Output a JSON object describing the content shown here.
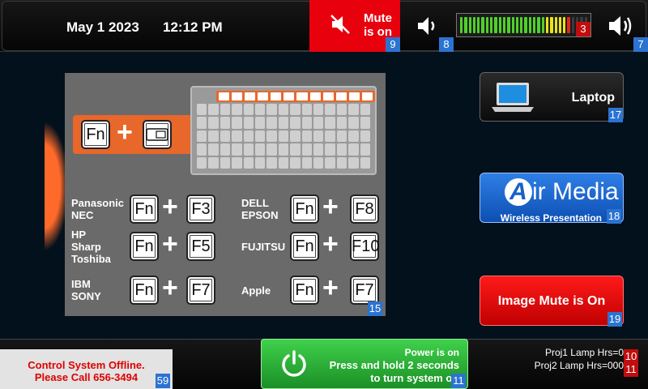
{
  "header": {
    "date": "May 1 2023",
    "time": "12:12 PM",
    "mute": {
      "line1": "Mute",
      "line2": "is on",
      "badge": "9"
    },
    "vol_down_badge": "8",
    "meter": {
      "level_fraction": 0.88,
      "badge": "3"
    },
    "vol_up_badge": "7"
  },
  "guide": {
    "badge": "15",
    "combo_keys": {
      "fn": "Fn",
      "plus": "+"
    },
    "rows": [
      {
        "brand": "Panasonic\nNEC",
        "key": "F3"
      },
      {
        "brand": "DELL\nEPSON",
        "key": "F8"
      },
      {
        "brand": "HP\nSharp\nToshiba",
        "key": "F5"
      },
      {
        "brand": "FUJITSU",
        "key": "F10"
      },
      {
        "brand": "IBM\nSONY",
        "key": "F7"
      },
      {
        "brand": "Apple",
        "key": "F7"
      }
    ]
  },
  "sources": {
    "laptop": {
      "label": "Laptop",
      "badge": "17"
    },
    "airmedia": {
      "logo_a": "A",
      "logo_rest": "ir Media",
      "sub": "Wireless Presentation",
      "badge": "18"
    },
    "image_mute": {
      "label": "Image Mute is On",
      "badge": "19"
    }
  },
  "footer": {
    "offline": {
      "line1": "Control System Offline.",
      "line2": "Please Call 656-3494",
      "badge": "59"
    },
    "power": {
      "status": "Power is on",
      "instruction1": "Press and hold 2 seconds",
      "instruction2": "to turn system off",
      "badge": "11"
    },
    "lamp1": {
      "text": "Proj1 Lamp Hrs=0",
      "badge": "10"
    },
    "lamp2": {
      "text": "Proj2 Lamp Hrs=000",
      "badge": "11"
    }
  },
  "colors": {
    "mute_red": "#e8000d",
    "offline_text": "#e00000",
    "badge_blue": "#2b73d1",
    "power_green": "#2db83a"
  }
}
